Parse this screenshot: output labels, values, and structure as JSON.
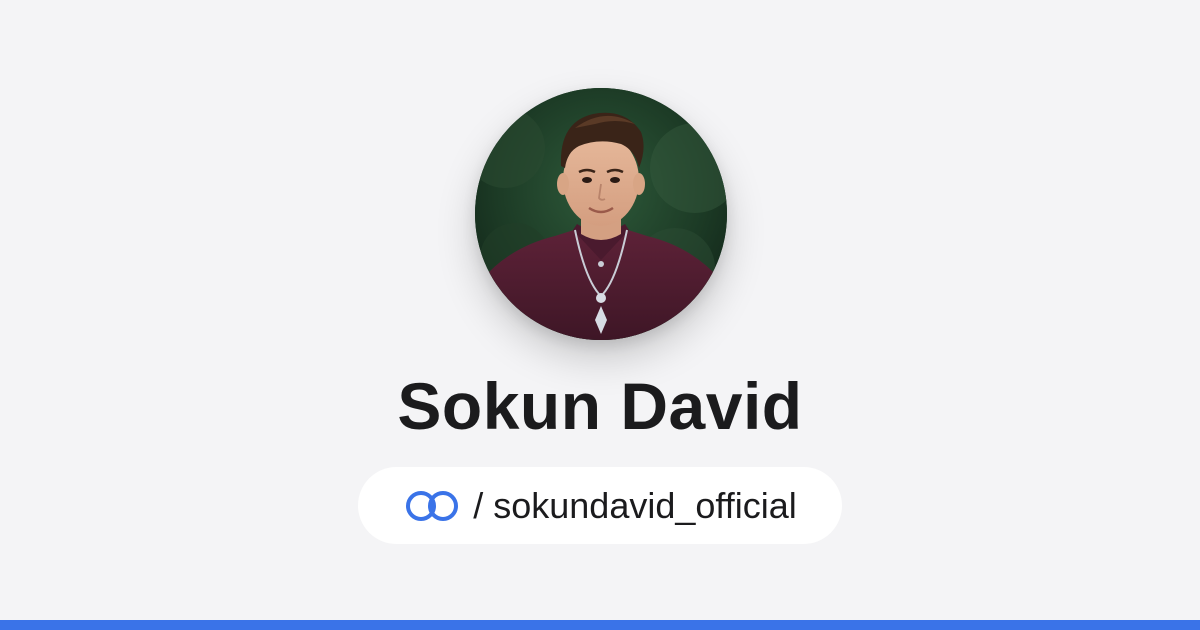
{
  "profile": {
    "name": "Sokun David",
    "avatar_alt": "Sokun David",
    "handle": {
      "separator": "/",
      "username": "sokundavid_official",
      "icon": "link-rings-icon"
    }
  },
  "colors": {
    "background": "#f4f4f6",
    "accent": "#3a73e8",
    "text": "#1b1b1d",
    "pill": "#ffffff"
  }
}
